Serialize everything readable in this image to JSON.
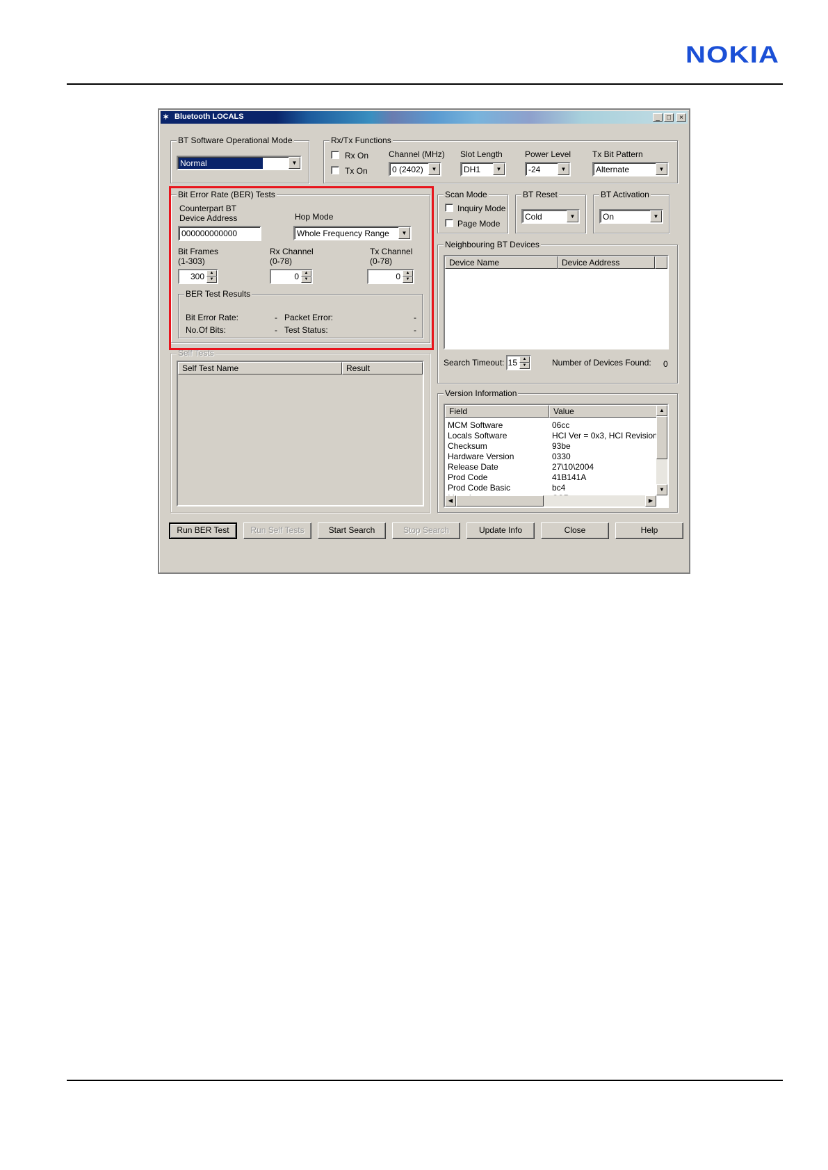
{
  "header": {
    "logo": "NOKIA"
  },
  "window": {
    "title": "Bluetooth LOCALS",
    "controls": {
      "minimize": "_",
      "maximize": "□",
      "close": "×"
    }
  },
  "op_mode": {
    "legend": "BT Software Operational Mode",
    "value": "Normal"
  },
  "rxtx": {
    "legend": "Rx/Tx Functions",
    "rx_on": "Rx On",
    "tx_on": "Tx On",
    "channel_label": "Channel (MHz)",
    "channel_value": "0   (2402)",
    "slot_label": "Slot Length",
    "slot_value": "DH1",
    "power_label": "Power Level",
    "power_value": "-24",
    "pattern_label": "Tx Bit Pattern",
    "pattern_value": "Alternate"
  },
  "ber": {
    "legend": "Bit Error Rate (BER) Tests",
    "addr_label_1": "Counterpart BT",
    "addr_label_2": "Device Address",
    "addr_value": "000000000000",
    "hop_label": "Hop Mode",
    "hop_value": "Whole Frequency Range",
    "frames_label_1": "Bit Frames",
    "frames_label_2": "(1-303)",
    "frames_value": "300",
    "rx_label_1": "Rx Channel",
    "rx_label_2": "(0-78)",
    "rx_value": "0",
    "tx_label_1": "Tx Channel",
    "tx_label_2": "(0-78)",
    "tx_value": "0",
    "results": {
      "legend": "BER Test Results",
      "ber_label": "Bit Error Rate:",
      "ber_value": "-",
      "bits_label": "No.Of Bits:",
      "bits_value": "-",
      "packet_label": "Packet Error:",
      "packet_value": "-",
      "status_label": "Test Status:",
      "status_value": "-"
    }
  },
  "self_tests": {
    "legend": "Self Tests",
    "col_name": "Self Test Name",
    "col_result": "Result"
  },
  "scan": {
    "legend": "Scan Mode",
    "inquiry": "Inquiry Mode",
    "page": "Page Mode"
  },
  "reset": {
    "legend": "BT Reset",
    "value": "Cold"
  },
  "activation": {
    "legend": "BT Activation",
    "value": "On"
  },
  "neighbours": {
    "legend": "Neighbouring BT Devices",
    "col_name": "Device Name",
    "col_addr": "Device Address",
    "timeout_label": "Search Timeout:",
    "timeout_value": "15",
    "found_label": "Number of Devices Found:",
    "found_value": "0"
  },
  "version": {
    "legend": "Version Information",
    "col_field": "Field",
    "col_value": "Value",
    "rows": [
      {
        "field": "MCM Software",
        "value": "06cc"
      },
      {
        "field": "Locals Software",
        "value": "HCI Ver = 0x3, HCI Revision"
      },
      {
        "field": "Checksum",
        "value": "93be"
      },
      {
        "field": "Hardware Version",
        "value": "0330"
      },
      {
        "field": "Release Date",
        "value": "27\\10\\2004"
      },
      {
        "field": "Prod Code",
        "value": "41B141A"
      },
      {
        "field": "Prod Code Basic",
        "value": "bc4"
      },
      {
        "field": "Manufacturer",
        "value": "CSR"
      }
    ]
  },
  "buttons": {
    "run_ber": "Run BER Test",
    "run_self": "Run Self Tests",
    "start_search": "Start Search",
    "stop_search": "Stop Search",
    "update_info": "Update Info",
    "close": "Close",
    "help": "Help"
  }
}
